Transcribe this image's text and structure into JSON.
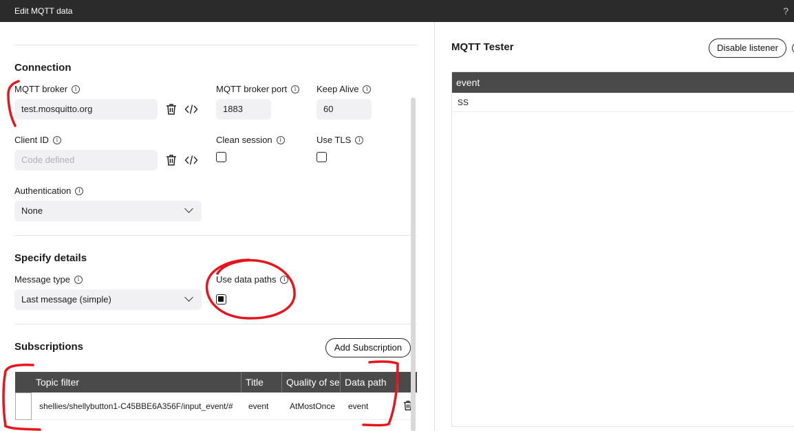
{
  "window": {
    "title": "Edit MQTT data",
    "help_glyph": "?"
  },
  "connection": {
    "heading": "Connection",
    "broker": {
      "label": "MQTT broker",
      "value": "test.mosquitto.org"
    },
    "port": {
      "label": "MQTT broker port",
      "value": "1883"
    },
    "keep_alive": {
      "label": "Keep Alive",
      "value": "60"
    },
    "client_id": {
      "label": "Client ID",
      "placeholder": "Code defined"
    },
    "clean_session": {
      "label": "Clean session",
      "checked": false
    },
    "use_tls": {
      "label": "Use TLS",
      "checked": false
    },
    "authentication": {
      "label": "Authentication",
      "value": "None"
    }
  },
  "details": {
    "heading": "Specify details",
    "message_type": {
      "label": "Message type",
      "value": "Last message (simple)"
    },
    "use_data_paths": {
      "label": "Use data paths",
      "checked": true
    }
  },
  "subscriptions": {
    "heading": "Subscriptions",
    "add_button": "Add Subscription",
    "columns": [
      "Topic filter",
      "Title",
      "Quality of se",
      "Data path"
    ],
    "rows": [
      {
        "topic": "shellies/shellybutton1-C45BBE6A356F/input_event/#",
        "title": "event",
        "qos": "AtMostOnce",
        "data_path": "event"
      }
    ]
  },
  "tester": {
    "title": "MQTT Tester",
    "disable_button": "Disable listener",
    "column": "event",
    "rows": [
      "SS"
    ]
  },
  "icons": {
    "info": "info-icon",
    "delete": "trash-icon",
    "code": "code-icon",
    "dropdown": "chevron-down-icon"
  },
  "colors": {
    "header_bg": "#2b2b2b",
    "table_header_bg": "#4a4a4a",
    "input_bg": "#f1f1f4",
    "annotation": "#e8141c"
  }
}
